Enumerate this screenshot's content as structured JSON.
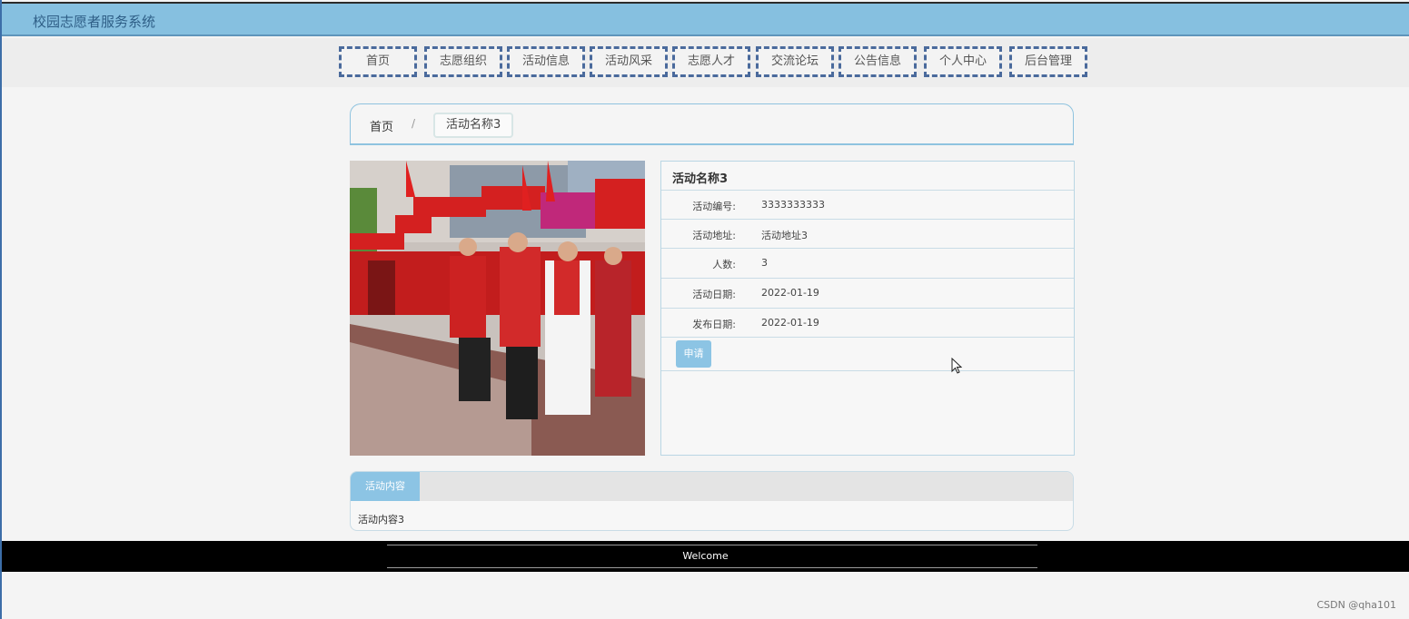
{
  "site": {
    "title": "校园志愿者服务系统"
  },
  "nav": {
    "items": [
      {
        "label": "首页"
      },
      {
        "label": "志愿组织"
      },
      {
        "label": "活动信息"
      },
      {
        "label": "活动风采"
      },
      {
        "label": "志愿人才"
      },
      {
        "label": "交流论坛"
      },
      {
        "label": "公告信息"
      },
      {
        "label": "个人中心"
      },
      {
        "label": "后台管理"
      }
    ]
  },
  "breadcrumb": {
    "home": "首页",
    "separator": "/",
    "current": "活动名称3"
  },
  "photo": {
    "icon": "volunteer-activity-photo"
  },
  "detail": {
    "title": "活动名称3",
    "rows": [
      {
        "label": "活动编号:",
        "value": "3333333333"
      },
      {
        "label": "活动地址:",
        "value": "活动地址3"
      },
      {
        "label": "人数:",
        "value": "3"
      },
      {
        "label": "活动日期:",
        "value": "2022-01-19"
      },
      {
        "label": "发布日期:",
        "value": "2022-01-19"
      }
    ],
    "apply_label": "申请"
  },
  "content": {
    "tab_label": "活动内容",
    "text": "活动内容3"
  },
  "footer": {
    "text": "Welcome"
  },
  "watermark": "CSDN @qha101",
  "colors": {
    "header": "#86c0e0",
    "accent": "#8cc4e4",
    "nav_border": "#4a6a9c",
    "footer": "#000000"
  }
}
